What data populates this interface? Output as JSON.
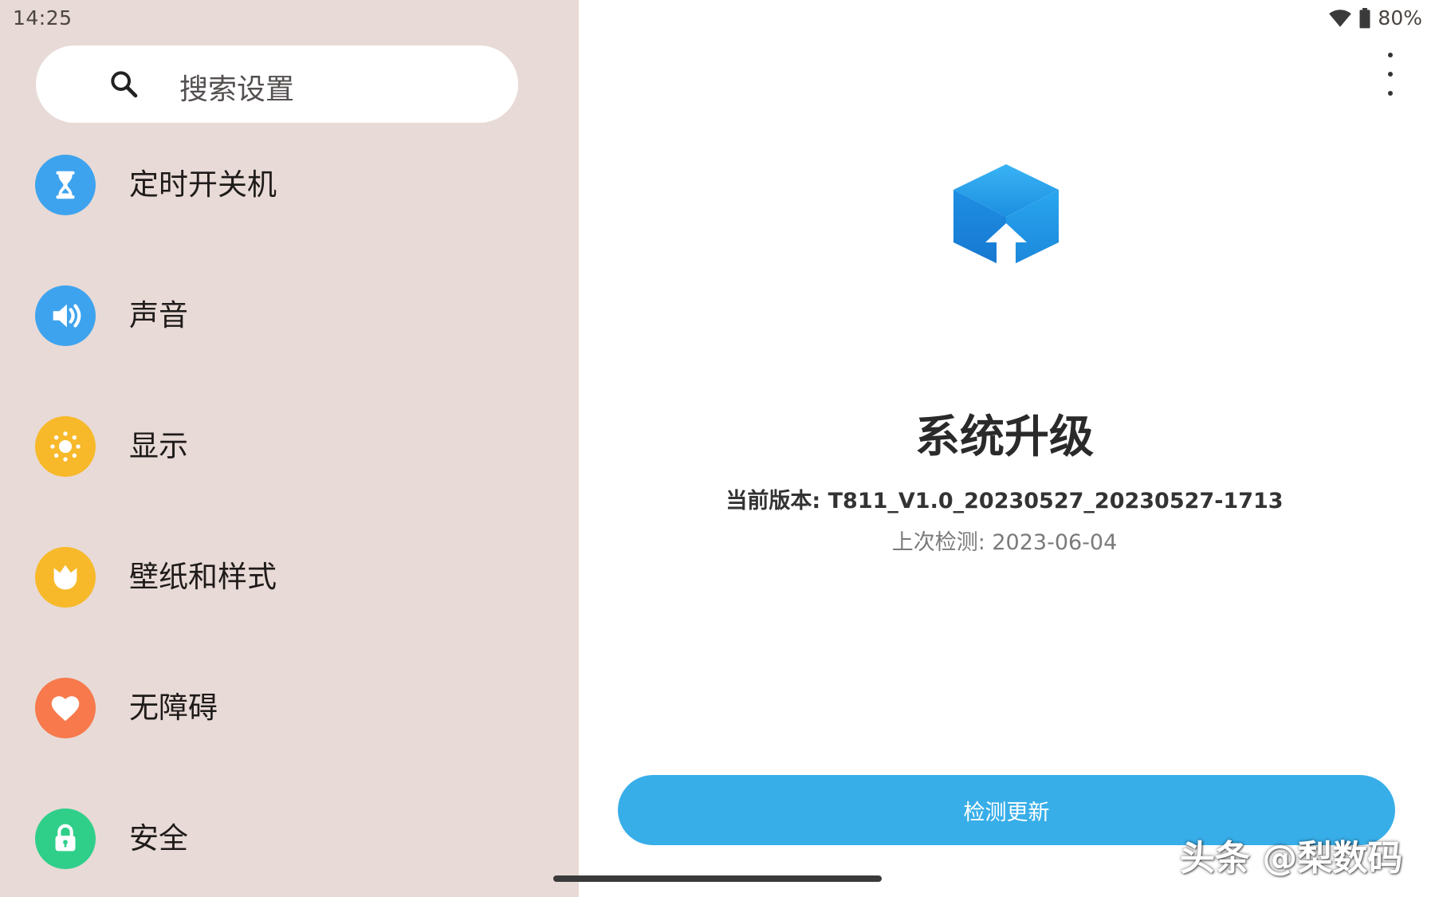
{
  "status_bar": {
    "time": "14:25",
    "battery": "80%"
  },
  "search": {
    "placeholder": "搜索设置"
  },
  "sidebar": {
    "items": [
      {
        "label": "定时开关机",
        "icon": "hourglass-icon",
        "color": "#3ea3ee"
      },
      {
        "label": "声音",
        "icon": "speaker-icon",
        "color": "#3ea3ee"
      },
      {
        "label": "显示",
        "icon": "brightness-icon",
        "color": "#f7b92a"
      },
      {
        "label": "壁纸和样式",
        "icon": "tulip-icon",
        "color": "#f7b92a"
      },
      {
        "label": "无障碍",
        "icon": "heart-icon",
        "color": "#f7794c"
      },
      {
        "label": "安全",
        "icon": "lock-icon",
        "color": "#2fcf8a"
      }
    ]
  },
  "main": {
    "title": "系统升级",
    "current_version": "当前版本: T811_V1.0_20230527_20230527-1713",
    "last_check": "上次检测: 2023-06-04",
    "check_button": "检测更新",
    "accent_color": "#38aee9"
  },
  "watermark": "头条 @梨数码"
}
